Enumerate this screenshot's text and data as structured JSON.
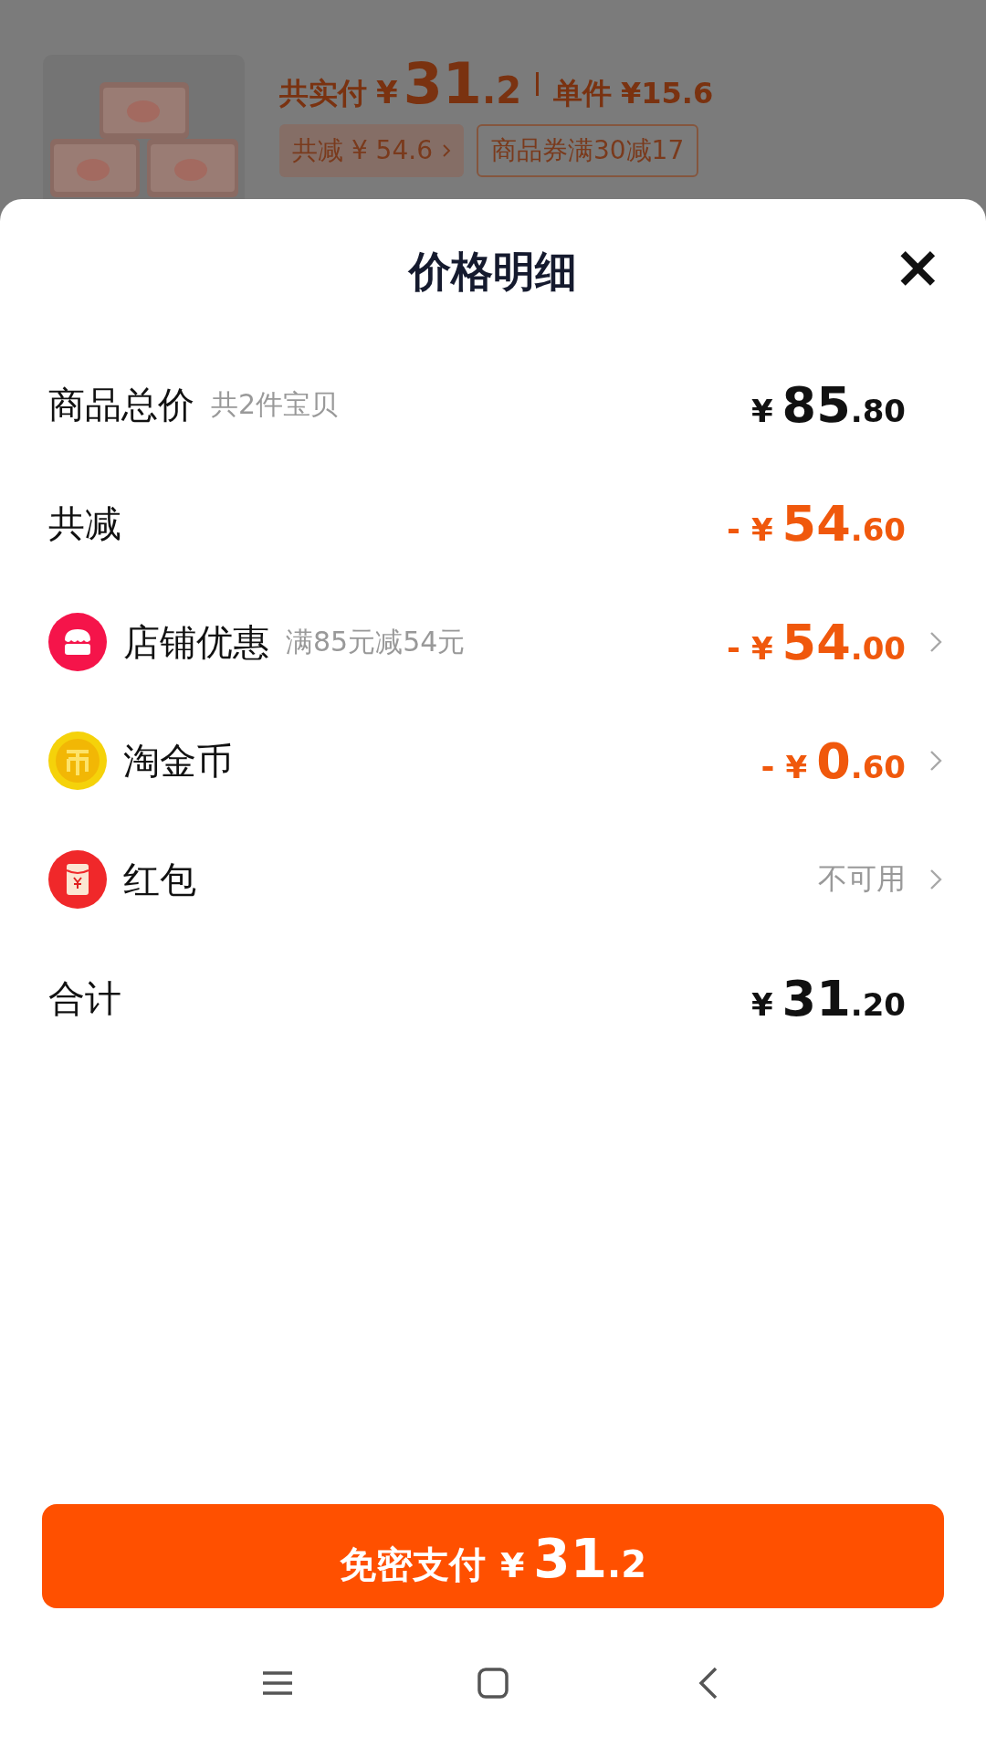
{
  "order_preview": {
    "paid_label": "共实付",
    "currency": "¥",
    "paid_integer": "31",
    "paid_decimal": ".2",
    "unit_label": "单件",
    "unit_price": "¥15.6",
    "tags": [
      {
        "text": "共减 ¥ 54.6",
        "kind": "filled"
      },
      {
        "text": "商品券满30减17",
        "kind": "outline"
      }
    ]
  },
  "sheet": {
    "title": "价格明细",
    "close": "×",
    "rows": [
      {
        "kind": "plain",
        "label": "商品总价",
        "note": "共2件宝贝",
        "amount": {
          "currency": "¥",
          "integer": "85",
          "decimal": ".80"
        },
        "discount": false,
        "chevron": false
      },
      {
        "kind": "plain",
        "label": "共减",
        "amount": {
          "sign": "-",
          "currency": "¥",
          "integer": "54",
          "decimal": ".60"
        },
        "discount": true,
        "chevron": false
      },
      {
        "kind": "store",
        "label": "店铺优惠",
        "note": "满85元减54元",
        "amount": {
          "sign": "-",
          "currency": "¥",
          "integer": "54",
          "decimal": ".00"
        },
        "discount": true,
        "chevron": true
      },
      {
        "kind": "coin",
        "label": "淘金币",
        "amount": {
          "sign": "-",
          "currency": "¥",
          "integer": "0",
          "decimal": ".60"
        },
        "discount": true,
        "chevron": true
      },
      {
        "kind": "redpacket",
        "label": "红包",
        "status": "不可用",
        "chevron": true
      },
      {
        "kind": "plain",
        "label": "合计",
        "amount": {
          "currency": "¥",
          "integer": "31",
          "decimal": ".20"
        },
        "discount": false,
        "chevron": false
      }
    ],
    "pay_button": {
      "label": "免密支付",
      "currency": "¥",
      "integer": "31",
      "decimal": ".2"
    }
  }
}
